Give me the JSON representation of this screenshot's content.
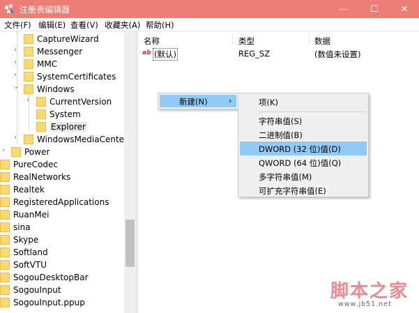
{
  "window": {
    "title": "注册表编辑器",
    "min": "—",
    "max": "☐",
    "close": "✕"
  },
  "menubar": [
    "文件(F)",
    "编辑(E)",
    "查看(V)",
    "收藏夹(A)",
    "帮助(H)"
  ],
  "tree": {
    "items": [
      "CaptureWizard",
      "Messenger",
      "MMC",
      "SystemCertificates",
      "Windows",
      "CurrentVersion",
      "System",
      "Explorer",
      "WindowsMediaCenter",
      "Power",
      "PureCodec",
      "RealNetworks",
      "Realtek",
      "RegisteredApplications",
      "RuanMei",
      "sina",
      "Skype",
      "Softland",
      "SoftVTU",
      "SogouDesktopBar",
      "SogouInput",
      "SogouInput.ppup"
    ],
    "selected": "Explorer"
  },
  "list": {
    "headers": [
      "名称",
      "类型",
      "数据"
    ],
    "rows": [
      {
        "name": "(默认)",
        "type": "REG_SZ",
        "data": "(数值未设置)"
      }
    ]
  },
  "context_menu": {
    "new_label": "新建(N)",
    "arrow": "›"
  },
  "submenu": {
    "items": [
      "项(K)",
      "字符串值(S)",
      "二进制值(B)",
      "DWORD (32 位)值(D)",
      "QWORD (64 位)值(Q)",
      "多字符串值(M)",
      "可扩充字符串值(E)"
    ],
    "highlighted": "DWORD (32 位)值(D)"
  },
  "watermark": {
    "text": "脚本之家",
    "url": "www.jb51.net"
  },
  "colors": {
    "titlebar": "#eb7f76",
    "highlight": "#91c9f7",
    "folder": "#fcd971"
  }
}
